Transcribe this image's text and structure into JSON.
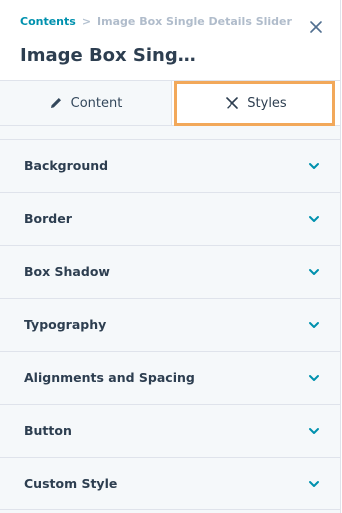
{
  "breadcrumb": {
    "root": "Contents",
    "separator": ">",
    "current": "Image Box Single Details Slider"
  },
  "page_title": "Image Box Sing…",
  "tabs": [
    {
      "label": "Content",
      "icon": "pencil-icon",
      "active": false
    },
    {
      "label": "Styles",
      "icon": "styles-icon",
      "active": true
    }
  ],
  "sections": [
    {
      "label": "Background"
    },
    {
      "label": "Border"
    },
    {
      "label": "Box Shadow"
    },
    {
      "label": "Typography"
    },
    {
      "label": "Alignments and Spacing"
    },
    {
      "label": "Button"
    },
    {
      "label": "Custom Style"
    }
  ],
  "colors": {
    "accent": "#0091ae",
    "highlight": "#f2a85a",
    "text": "#2d3e50",
    "background": "#f5f8fa"
  }
}
